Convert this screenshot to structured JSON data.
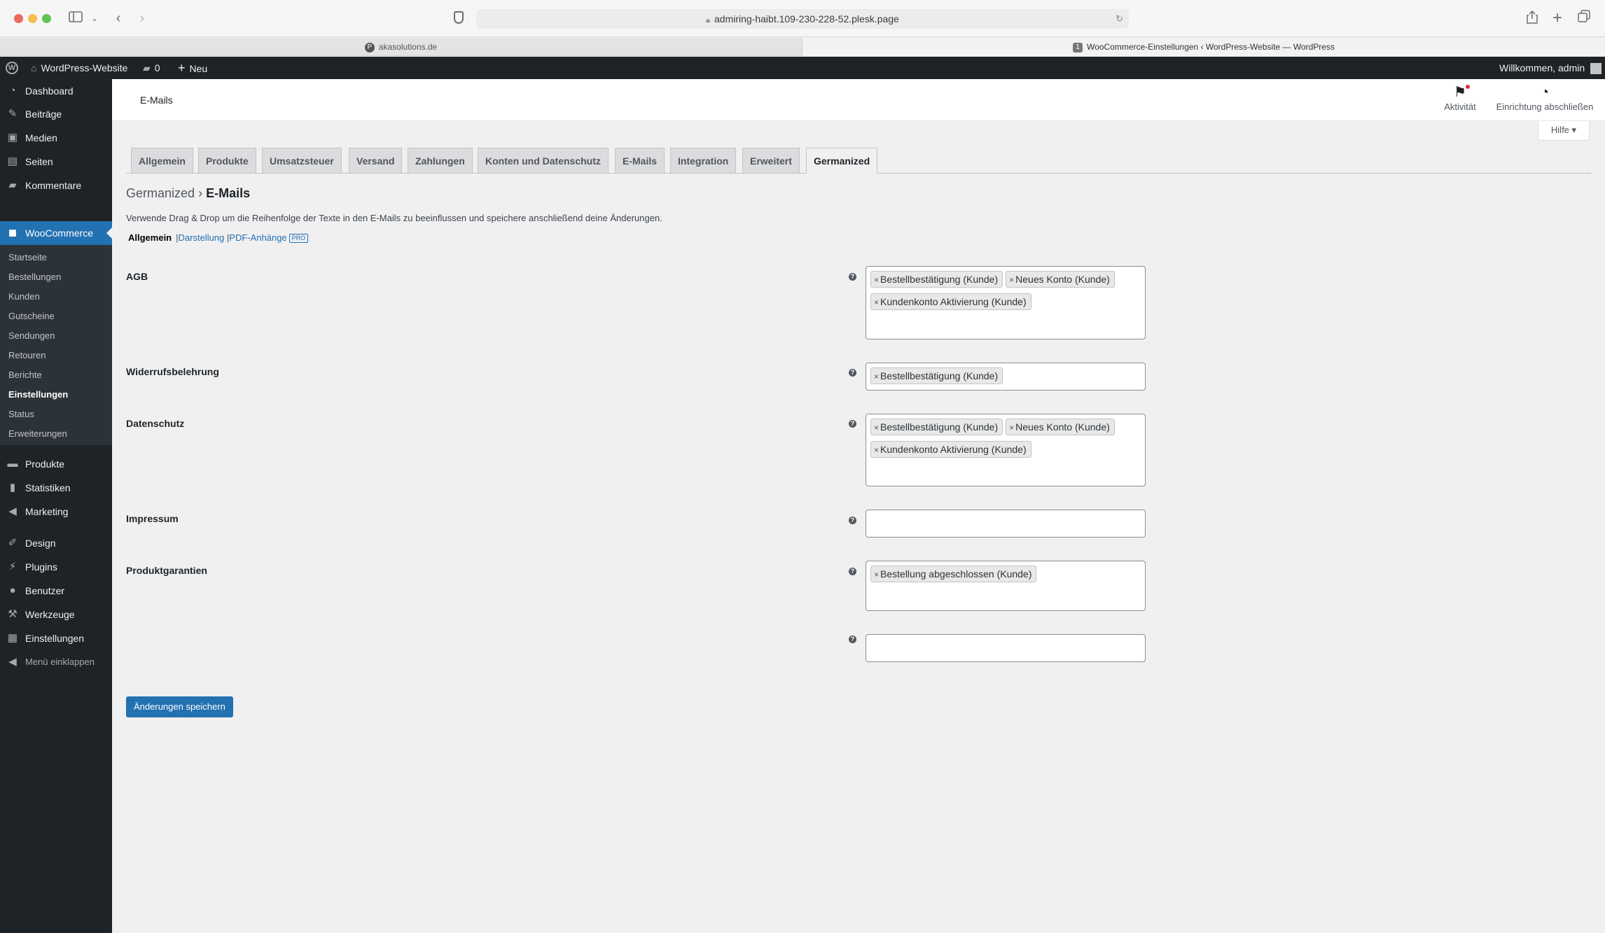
{
  "browser": {
    "url": "admiring-haibt.109-230-228-52.plesk.page",
    "tabs": [
      {
        "label": "akasolutions.de"
      },
      {
        "label": "WooCommerce-Einstellungen ‹ WordPress-Website — WordPress"
      }
    ]
  },
  "adminbar": {
    "site_name": "WordPress-Website",
    "comments_count": "0",
    "new_label": "Neu",
    "welcome": "Willkommen, admin"
  },
  "sidebar": {
    "items": [
      {
        "label": "Dashboard",
        "icon": "dashboard-icon"
      },
      {
        "label": "Beiträge",
        "icon": "pin-icon"
      },
      {
        "label": "Medien",
        "icon": "media-icon"
      },
      {
        "label": "Seiten",
        "icon": "page-icon"
      },
      {
        "label": "Kommentare",
        "icon": "comment-icon"
      },
      {
        "label": "WooCommerce",
        "icon": "woo-icon"
      }
    ],
    "submenu": [
      "Startseite",
      "Bestellungen",
      "Kunden",
      "Gutscheine",
      "Sendungen",
      "Retouren",
      "Berichte",
      "Einstellungen",
      "Status",
      "Erweiterungen"
    ],
    "items2": [
      {
        "label": "Produkte",
        "icon": "products-icon"
      },
      {
        "label": "Statistiken",
        "icon": "stats-icon"
      },
      {
        "label": "Marketing",
        "icon": "megaphone-icon"
      },
      {
        "label": "Design",
        "icon": "brush-icon"
      },
      {
        "label": "Plugins",
        "icon": "plug-icon"
      },
      {
        "label": "Benutzer",
        "icon": "user-icon"
      },
      {
        "label": "Werkzeuge",
        "icon": "wrench-icon"
      },
      {
        "label": "Einstellungen",
        "icon": "settings-icon"
      },
      {
        "label": "Menü einklappen",
        "icon": "collapse-icon"
      }
    ]
  },
  "header": {
    "title": "E-Mails",
    "activity": "Aktivität",
    "setup": "Einrichtung abschließen",
    "help": "Hilfe"
  },
  "tabs": [
    "Allgemein",
    "Produkte",
    "Umsatzsteuer",
    "Versand",
    "Zahlungen",
    "Konten und Datenschutz",
    "E-Mails",
    "Integration",
    "Erweitert",
    "Germanized"
  ],
  "page": {
    "breadcrumb_parent": "Germanized",
    "breadcrumb_current": "E-Mails",
    "description": "Verwende Drag & Drop um die Reihenfolge der Texte in den E-Mails zu beeinflussen und speichere anschließend deine Änderungen.",
    "subnav": {
      "current": "Allgemein",
      "link1": "Darstellung",
      "link2": "PDF-Anhänge",
      "badge": "PRO"
    }
  },
  "fields": [
    {
      "label": "AGB",
      "values": [
        "Bestellbestätigung (Kunde)",
        "Neues Konto (Kunde)",
        "Kundenkonto Aktivierung (Kunde)"
      ]
    },
    {
      "label": "Widerrufsbelehrung",
      "values": [
        "Bestellbestätigung (Kunde)"
      ]
    },
    {
      "label": "Datenschutz",
      "values": [
        "Bestellbestätigung (Kunde)",
        "Neues Konto (Kunde)",
        "Kundenkonto Aktivierung (Kunde)"
      ]
    },
    {
      "label": "Impressum",
      "values": []
    },
    {
      "label": "Produktgarantien",
      "values": [
        "Bestellung abgeschlossen (Kunde)"
      ]
    },
    {
      "label": "",
      "values": []
    }
  ],
  "save_label": "Änderungen speichern"
}
